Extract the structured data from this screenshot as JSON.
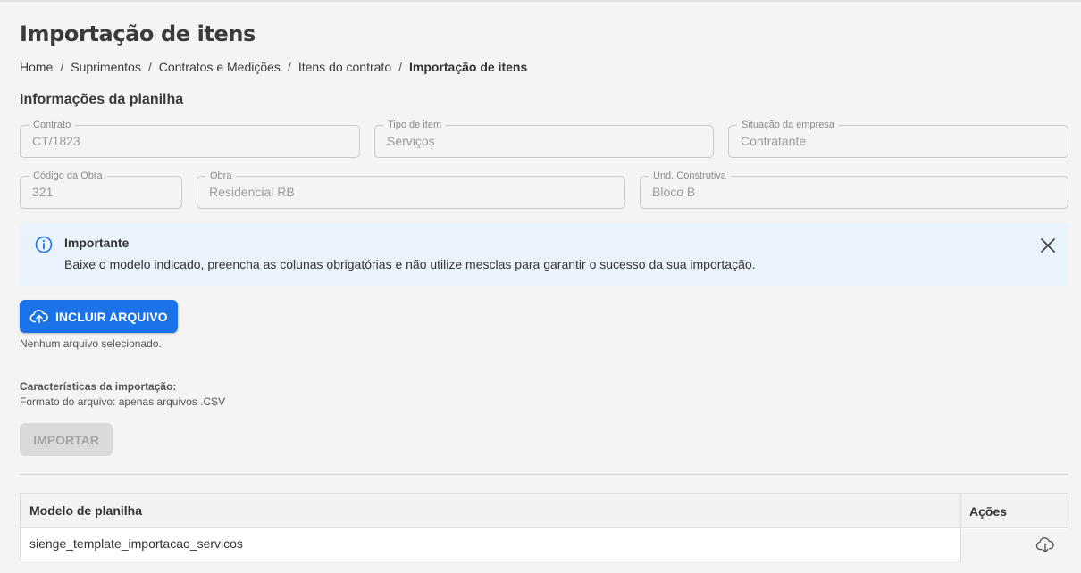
{
  "page": {
    "title": "Importação de itens",
    "breadcrumb": [
      "Home",
      "Suprimentos",
      "Contratos e Medições",
      "Itens do contrato"
    ],
    "breadcrumb_current": "Importação de itens",
    "separator": "/"
  },
  "info_section": {
    "title": "Informações da planilha",
    "fields": {
      "contrato": {
        "label": "Contrato",
        "value": "CT/1823"
      },
      "tipo_item": {
        "label": "Tipo de item",
        "value": "Serviços"
      },
      "situacao_empresa": {
        "label": "Situação da empresa",
        "value": "Contratante"
      },
      "codigo_obra": {
        "label": "Código da Obra",
        "value": "321"
      },
      "obra": {
        "label": "Obra",
        "value": "Residencial RB"
      },
      "und_construtiva": {
        "label": "Und. Construtiva",
        "value": "Bloco B"
      }
    }
  },
  "alert": {
    "title": "Importante",
    "text": "Baixe o modelo indicado, preencha as colunas obrigatórias e não utilize mesclas para garantir o sucesso da sua importação.",
    "icon": "info-icon",
    "close_icon": "close-icon"
  },
  "upload": {
    "button_label": "INCLUIR ARQUIVO",
    "icon": "cloud-upload-icon",
    "status": "Nenhum arquivo selecionado."
  },
  "characteristics": {
    "title": "Características da importação:",
    "format": "Formato do arquivo: apenas arquivos .CSV"
  },
  "import_button": {
    "label": "IMPORTAR",
    "disabled": true
  },
  "table": {
    "headers": [
      "Modelo de planilha",
      "Ações"
    ],
    "rows": [
      {
        "model": "sienge_template_importacao_servicos",
        "action_icon": "cloud-download-icon"
      }
    ]
  },
  "colors": {
    "primary": "#1a73e8",
    "alert_bg": "#eaf2fb",
    "disabled_bg": "#dadada",
    "background": "#f4f4f4"
  }
}
